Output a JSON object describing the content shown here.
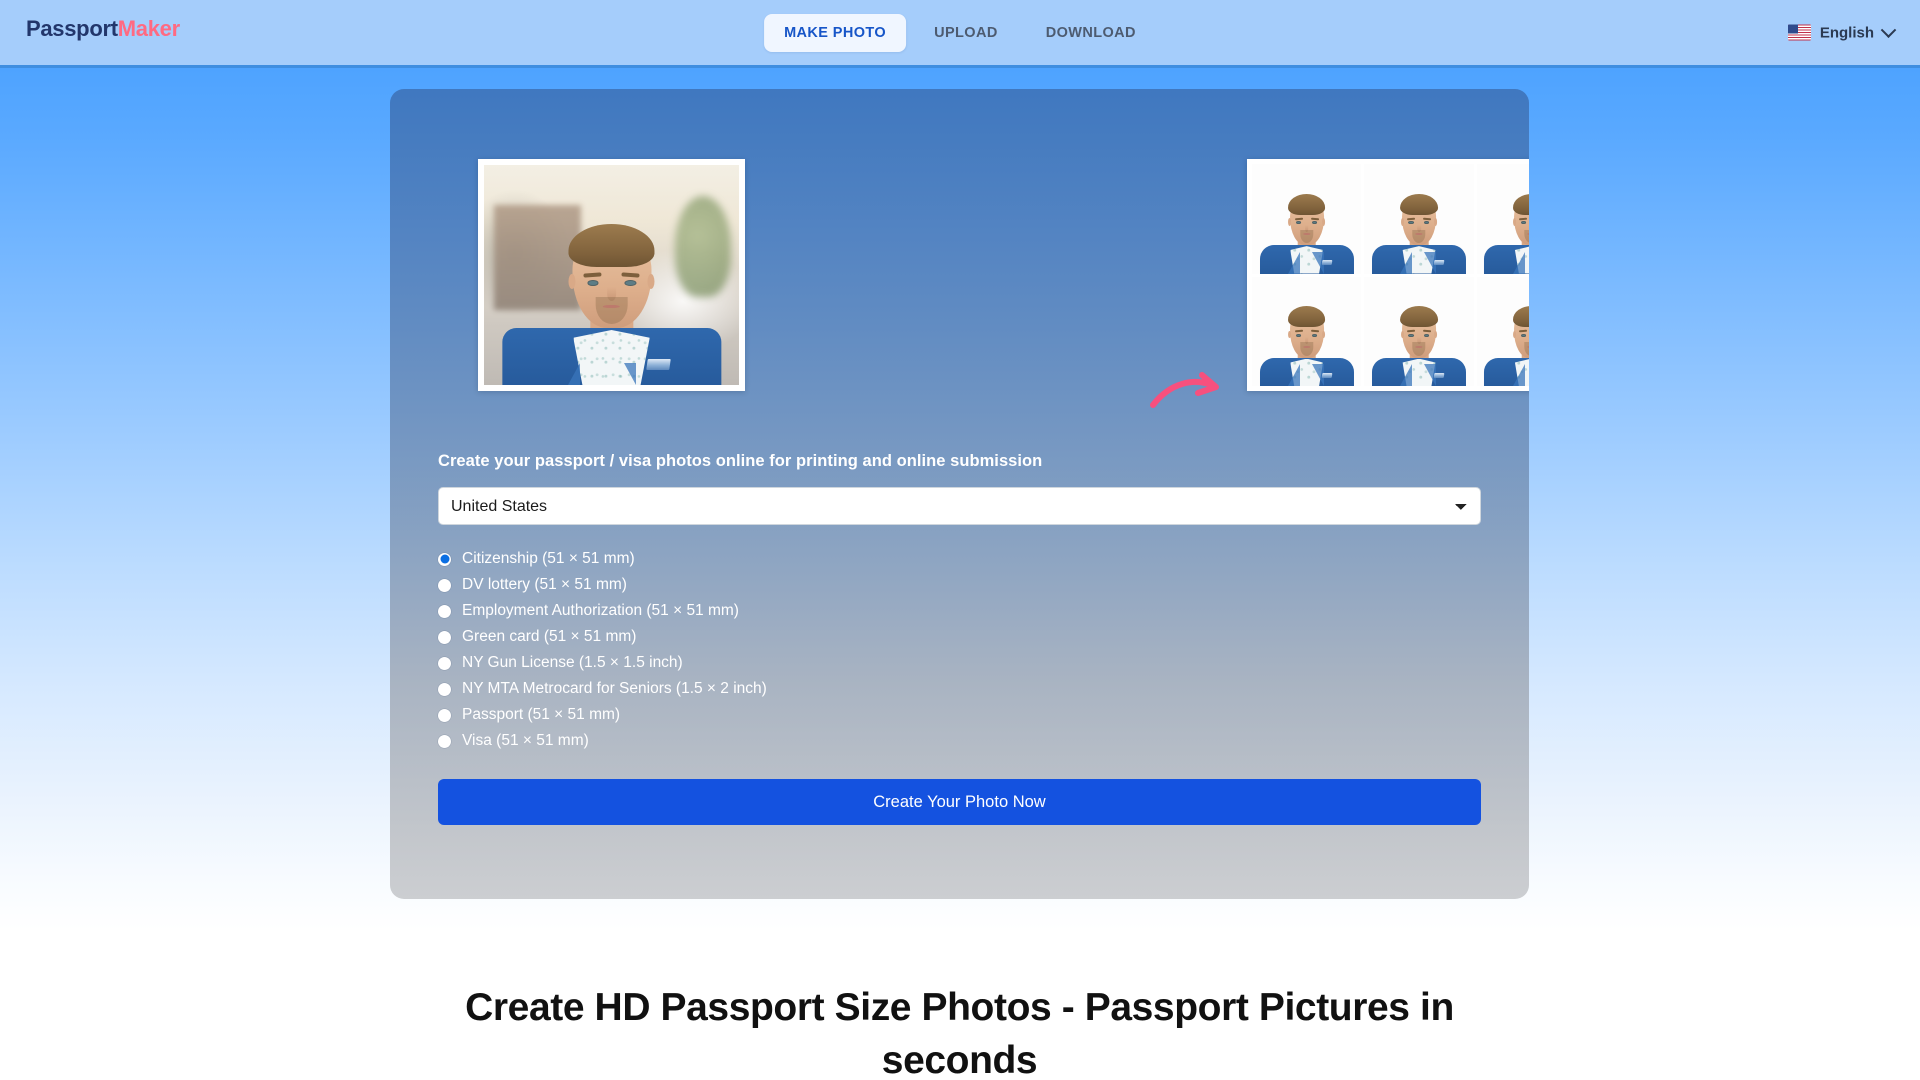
{
  "header": {
    "logo_primary": "Passport",
    "logo_secondary": "Maker",
    "nav": [
      {
        "label": "MAKE PHOTO",
        "active": true
      },
      {
        "label": "UPLOAD",
        "active": false
      },
      {
        "label": "DOWNLOAD",
        "active": false
      }
    ],
    "language": {
      "label": "English",
      "flag": "us-flag-icon",
      "chevron": "chevron-down-icon"
    },
    "background_color": "#a5cdfb",
    "active_tab_color": "#1655c8"
  },
  "hero": {
    "arrow_icon": "pink-curved-arrow-icon",
    "plus_icon": "plus-icon",
    "plus_color": "#f7507e",
    "original_photo_alt": "original portrait photo of man in blue suit outdoors",
    "sheet_photo_alt": "printable sheet with 6 passport photos",
    "single_photo_alt": "single digital passport photo on white background",
    "sheet_count": 6
  },
  "form": {
    "title": "Create your passport / visa photos online for printing and online submission",
    "country_selected": "United States",
    "country_options": [
      "United States"
    ],
    "document_types": [
      {
        "label": "Citizenship (51 × 51 mm)",
        "selected": true
      },
      {
        "label": "DV lottery (51 × 51 mm)",
        "selected": false
      },
      {
        "label": "Employment Authorization (51 × 51 mm)",
        "selected": false
      },
      {
        "label": "Green card (51 × 51 mm)",
        "selected": false
      },
      {
        "label": "NY Gun License (1.5 × 1.5 inch)",
        "selected": false
      },
      {
        "label": "NY MTA Metrocard for Seniors (1.5 × 2 inch)",
        "selected": false
      },
      {
        "label": "Passport (51 × 51 mm)",
        "selected": false
      },
      {
        "label": "Visa (51 × 51 mm)",
        "selected": false
      }
    ],
    "cta_label": "Create Your Photo Now",
    "cta_color": "#1452e0"
  },
  "content": {
    "section_heading": "Create HD Passport Size Photos - Passport Pictures in seconds"
  }
}
